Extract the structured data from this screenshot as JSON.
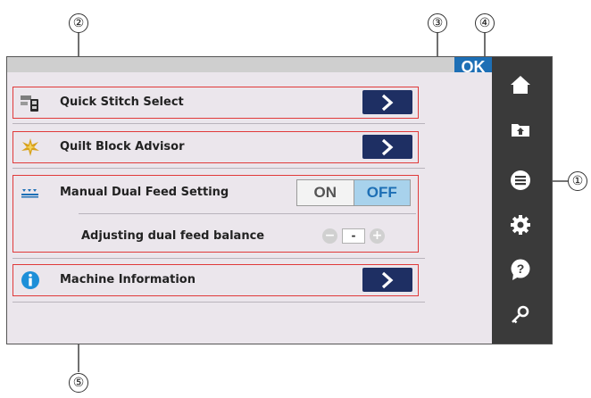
{
  "callouts": {
    "c1": "①",
    "c2": "②",
    "c3": "③",
    "c4": "④",
    "c5": "⑤"
  },
  "topbar": {
    "ok_label": "OK"
  },
  "rows": {
    "quick_stitch": {
      "label": "Quick Stitch Select"
    },
    "quilt_block": {
      "label": "Quilt Block Advisor"
    },
    "dual_feed": {
      "label": "Manual Dual Feed Setting",
      "on_label": "ON",
      "off_label": "OFF",
      "selected": "OFF"
    },
    "dual_balance": {
      "label": "Adjusting dual feed balance",
      "minus_label": "−",
      "value": "-",
      "plus_label": "+"
    },
    "machine_info": {
      "label": "Machine Information"
    }
  },
  "sidebar": {
    "items": [
      "home-icon",
      "folder-upload-icon",
      "menu-icon",
      "gear-icon",
      "help-icon",
      "key-icon"
    ]
  },
  "colors": {
    "ok_blue": "#1d6fb5",
    "arrow_button": "#1e2f63",
    "highlight_red": "#e03a3a",
    "off_highlight": "#a8d2ec",
    "sidebar": "#3a3a3a"
  }
}
